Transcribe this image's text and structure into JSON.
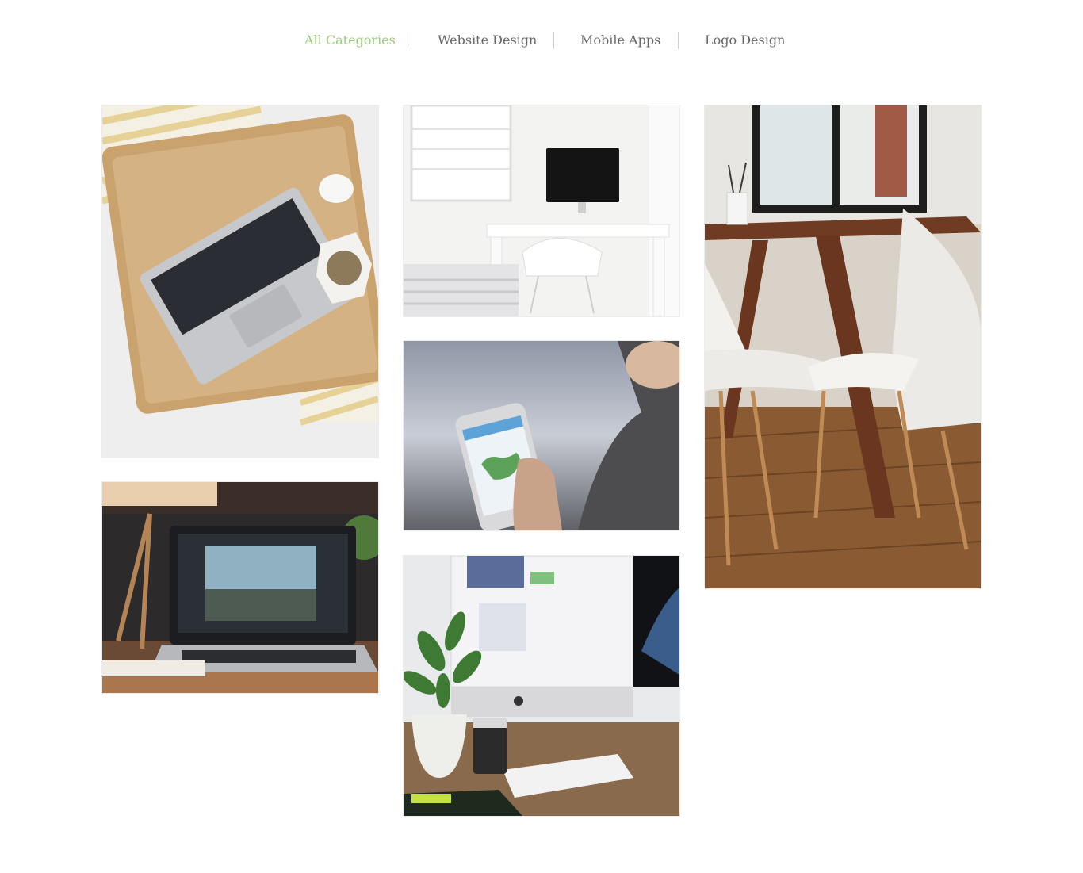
{
  "filters": {
    "items": [
      {
        "label": "All Categories",
        "active": true
      },
      {
        "label": "Website Design",
        "active": false
      },
      {
        "label": "Mobile Apps",
        "active": false
      },
      {
        "label": "Logo Design",
        "active": false
      }
    ],
    "active_color": "#9ccb7e",
    "inactive_color": "#666666"
  },
  "portfolio": {
    "items": [
      {
        "subject": "laptop on woven tray, overhead view"
      },
      {
        "subject": "laptop with photo editor on desk"
      },
      {
        "subject": "white desk with monitor and chair"
      },
      {
        "subject": "hand holding smartphone with map app"
      },
      {
        "subject": "desktop monitor with plant and keyboard"
      },
      {
        "subject": "wooden table with white chairs"
      }
    ]
  }
}
